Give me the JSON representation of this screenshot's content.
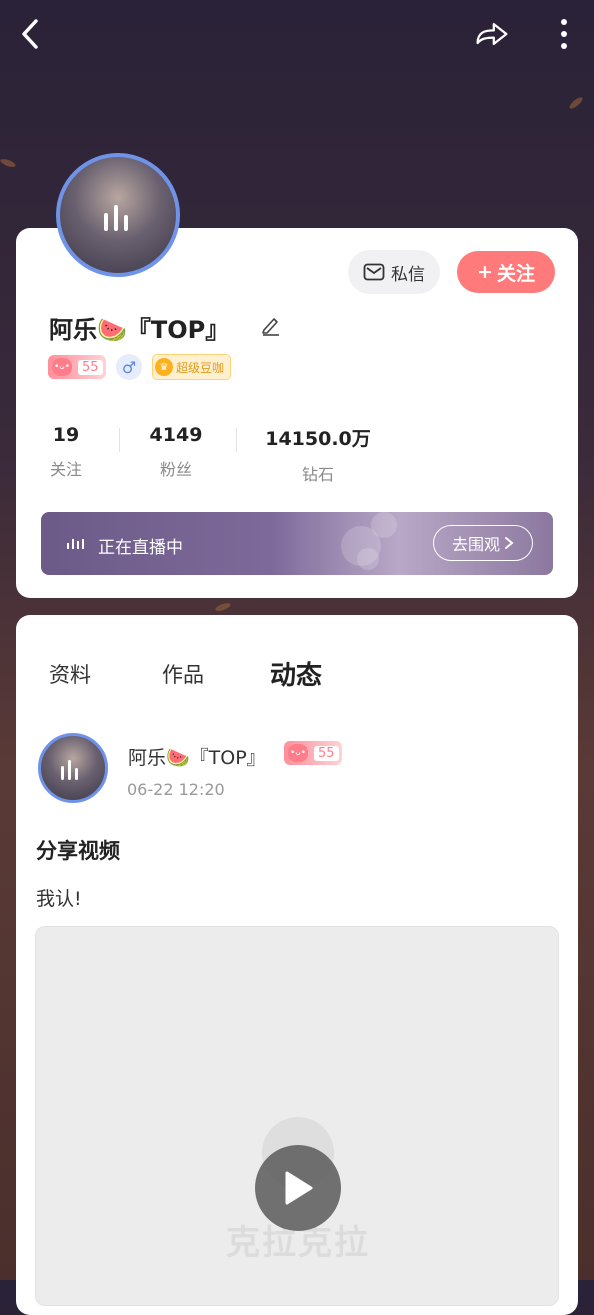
{
  "profile": {
    "name": "阿乐🍉『TOP』",
    "level": "55",
    "gender_symbol": "♂",
    "vip_label": "超级豆咖",
    "dm_label": "私信",
    "follow_label": "关注",
    "follow_prefix": "+",
    "stats": [
      {
        "value": "19",
        "label": "关注"
      },
      {
        "value": "4149",
        "label": "粉丝"
      },
      {
        "value": "14150.0万",
        "label": "钻石"
      }
    ],
    "live": {
      "status_text": "正在直播中",
      "go_label": "去围观"
    }
  },
  "tabs": [
    {
      "label": "资料",
      "active": false
    },
    {
      "label": "作品",
      "active": false
    },
    {
      "label": "动态",
      "active": true
    }
  ],
  "post": {
    "author": "阿乐🍉『TOP』",
    "level": "55",
    "time": "06-22 12:20",
    "title": "分享视频",
    "body": "我认!",
    "watermark": "克拉克拉"
  },
  "icons": {
    "back": "back-icon",
    "share": "share-icon",
    "more": "more-icon",
    "mail": "mail-icon",
    "edit": "edit-icon",
    "play": "play-icon"
  },
  "colors": {
    "accent": "#ff7a7a",
    "avatar_ring": "#6f93e8",
    "live_banner": "#6b5a87"
  }
}
